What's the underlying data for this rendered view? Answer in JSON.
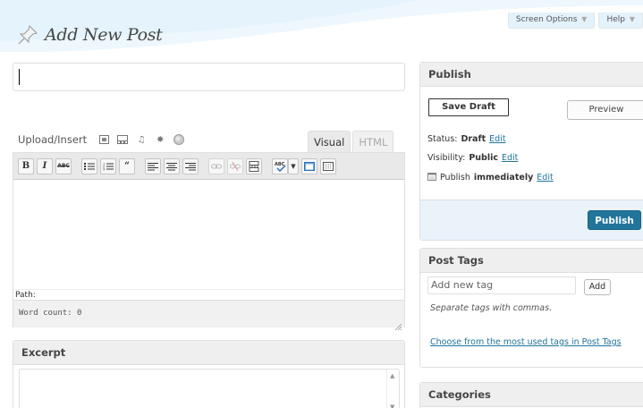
{
  "header": {
    "page_title": "Add New Post",
    "screen_options_label": "Screen Options",
    "help_label": "Help"
  },
  "post": {
    "title_value": ""
  },
  "media_bar": {
    "label": "Upload/Insert",
    "icons": [
      "add-image-icon",
      "add-video-icon",
      "add-audio-icon",
      "add-media-icon",
      "add-gallery-icon"
    ]
  },
  "editor": {
    "tabs": [
      {
        "label": "Visual",
        "active": true
      },
      {
        "label": "HTML",
        "active": false
      }
    ],
    "path_label": "Path:",
    "word_count_label": "Word count: 0",
    "toolbar_buttons": [
      "bold",
      "italic",
      "strikethrough",
      "bullet-list",
      "numbered-list",
      "blockquote",
      "align-left",
      "align-center",
      "align-right",
      "insert-link",
      "remove-link",
      "insert-more",
      "spellcheck",
      "fullscreen",
      "kitchen-sink"
    ]
  },
  "excerpt": {
    "title": "Excerpt",
    "value": ""
  },
  "publish": {
    "title": "Publish",
    "save_draft_label": "Save Draft",
    "preview_label": "Preview",
    "status_label": "Status:",
    "status_value": "Draft",
    "visibility_label": "Visibility:",
    "visibility_value": "Public",
    "publish_label": "Publish",
    "publish_value": "immediately",
    "edit_label": "Edit",
    "publish_button_label": "Publish"
  },
  "post_tags": {
    "title": "Post Tags",
    "input_placeholder": "Add new tag",
    "add_button_label": "Add",
    "hint": "Separate tags with commas.",
    "most_used_link": "Choose from the most used tags in Post Tags"
  },
  "categories": {
    "title": "Categories"
  },
  "colors": {
    "link": "#21759b",
    "publish_button": "#21759b",
    "box_header": "#efefef",
    "publish_footer": "#eaf2fa"
  }
}
